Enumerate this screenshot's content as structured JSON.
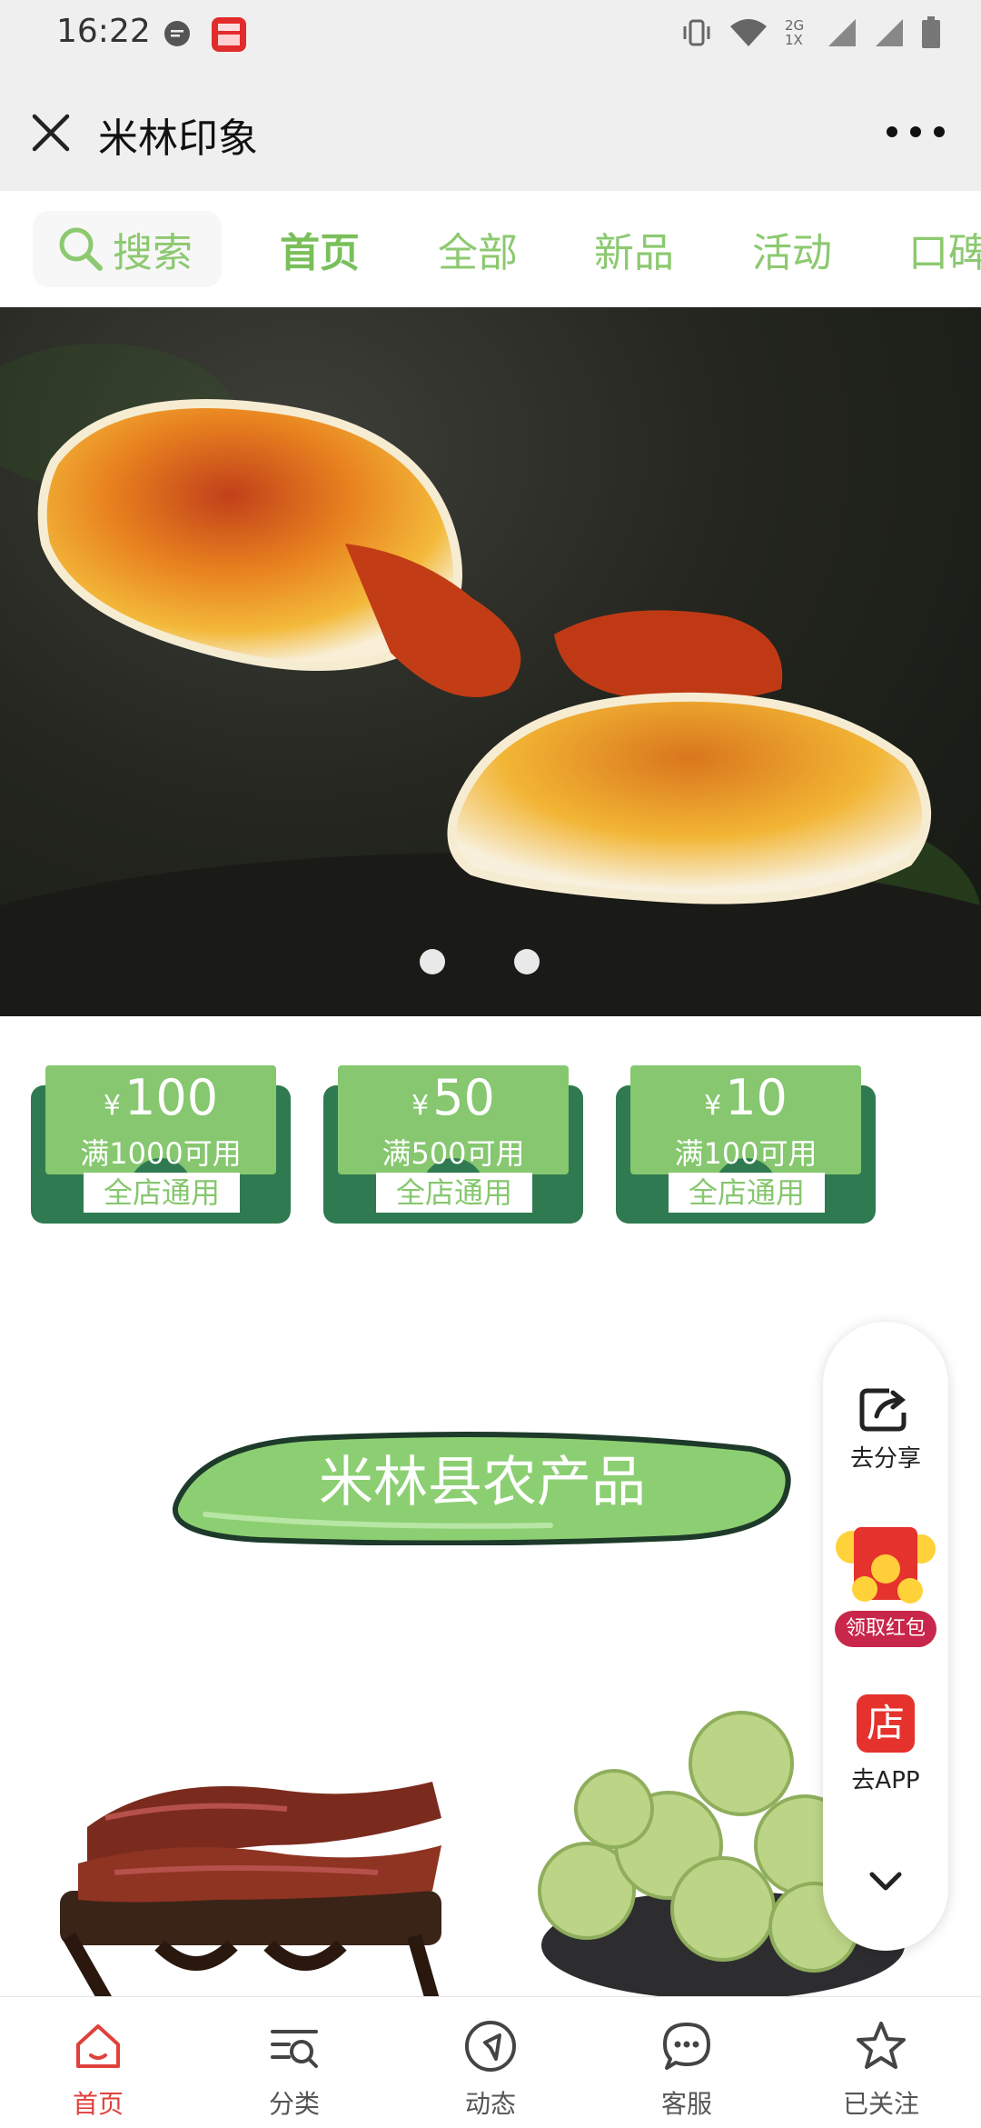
{
  "status_bar": {
    "time": "16:22",
    "network": "2G 1X"
  },
  "header": {
    "title": "米林印象"
  },
  "nav": {
    "search_label": "搜索",
    "tabs": [
      "首页",
      "全部",
      "新品",
      "活动",
      "口碑"
    ]
  },
  "coupons": [
    {
      "currency": "¥",
      "amount": "100",
      "condition": "满1000可用",
      "scope": "全店通用"
    },
    {
      "currency": "¥",
      "amount": "50",
      "condition": "满500可用",
      "scope": "全店通用"
    },
    {
      "currency": "¥",
      "amount": "10",
      "condition": "满100可用",
      "scope": "全店通用"
    }
  ],
  "side_panel": {
    "share_label": "去分享",
    "redpacket_label": "领取红包",
    "app_icon_text": "店",
    "app_label": "去APP"
  },
  "section": {
    "title": "米林县农产品"
  },
  "tabbar": {
    "items": [
      {
        "label": "首页"
      },
      {
        "label": "分类"
      },
      {
        "label": "动态"
      },
      {
        "label": "客服"
      },
      {
        "label": "已关注"
      }
    ]
  },
  "colors": {
    "accent_green": "#86c76f",
    "coupon_dark": "#2f7a50",
    "tab_active_red": "#e0413b"
  }
}
